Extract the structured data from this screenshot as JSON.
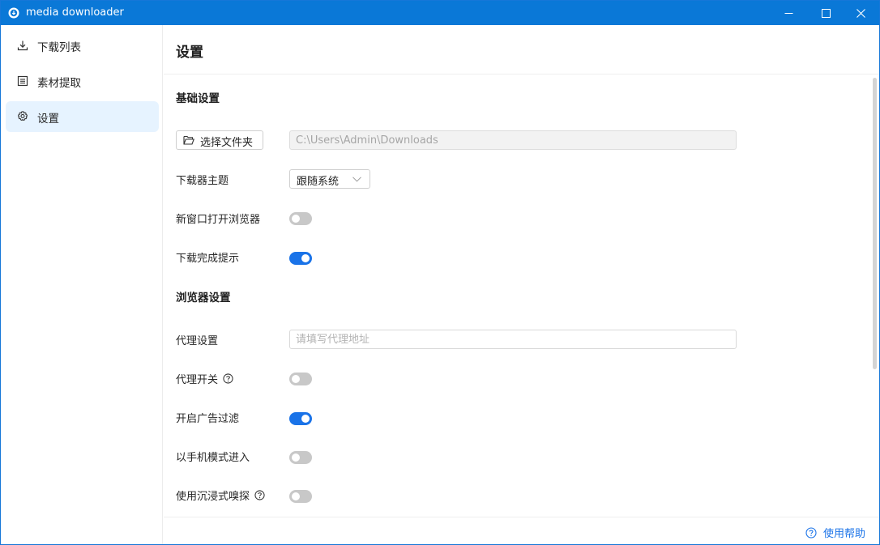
{
  "window": {
    "title": "media downloader",
    "accent_color": "#0a78d7"
  },
  "sidebar": {
    "items": [
      {
        "label": "下载列表",
        "icon": "download-icon",
        "active": false
      },
      {
        "label": "素材提取",
        "icon": "document-icon",
        "active": false
      },
      {
        "label": "设置",
        "icon": "gear-icon",
        "active": true
      }
    ]
  },
  "page": {
    "title": "设置"
  },
  "basic": {
    "section_title": "基础设置",
    "choose_folder_label": "选择文件夹",
    "download_path": "C:\\Users\\Admin\\Downloads",
    "theme_label": "下载器主题",
    "theme_value": "跟随系统",
    "new_window_label": "新窗口打开浏览器",
    "new_window_on": false,
    "complete_notice_label": "下载完成提示",
    "complete_notice_on": true
  },
  "browser": {
    "section_title": "浏览器设置",
    "proxy_label": "代理设置",
    "proxy_placeholder": "请填写代理地址",
    "proxy_switch_label": "代理开关",
    "proxy_switch_on": false,
    "ad_filter_label": "开启广告过滤",
    "ad_filter_on": true,
    "mobile_mode_label": "以手机模式进入",
    "mobile_mode_on": false,
    "immersive_label": "使用沉浸式嗅探",
    "immersive_on": false
  },
  "footer": {
    "help_label": "使用帮助"
  },
  "colors": {
    "toggle_on": "#1a73e8",
    "toggle_off": "#c8c8c8",
    "active_nav_bg": "#e6f3ff"
  }
}
